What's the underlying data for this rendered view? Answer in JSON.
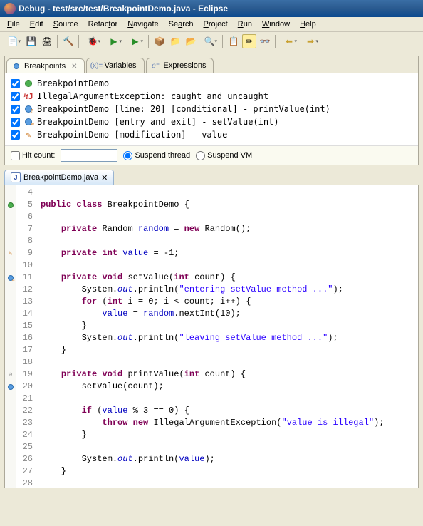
{
  "title": "Debug - test/src/test/BreakpointDemo.java - Eclipse",
  "menu": {
    "file": "File",
    "edit": "Edit",
    "source": "Source",
    "refactor": "Refactor",
    "navigate": "Navigate",
    "search": "Search",
    "project": "Project",
    "run": "Run",
    "window": "Window",
    "help": "Help"
  },
  "views": {
    "breakpoints": "Breakpoints",
    "variables": "Variables",
    "expressions": "Expressions"
  },
  "breakpoints": [
    {
      "label": "BreakpointDemo",
      "icon": "run"
    },
    {
      "label": "IllegalArgumentException: caught and uncaught",
      "icon": "exception"
    },
    {
      "label": "BreakpointDemo [line: 20] [conditional] - printValue(int)",
      "icon": "conditional"
    },
    {
      "label": "BreakpointDemo [entry and exit] - setValue(int)",
      "icon": "entry-exit"
    },
    {
      "label": "BreakpointDemo [modification] - value",
      "icon": "modification"
    }
  ],
  "bp_controls": {
    "hit_count_label": "Hit count:",
    "hit_count_value": "",
    "suspend_thread": "Suspend thread",
    "suspend_vm": "Suspend VM"
  },
  "editor_tab": "BreakpointDemo.java",
  "code": {
    "lines": [
      {
        "n": 4,
        "ruler": "",
        "html": ""
      },
      {
        "n": 5,
        "ruler": "run",
        "html": "<span class='kw'>public</span> <span class='kw'>class</span> BreakpointDemo {"
      },
      {
        "n": 6,
        "ruler": "",
        "html": ""
      },
      {
        "n": 7,
        "ruler": "",
        "html": "    <span class='kw'>private</span> Random <span class='field'>random</span> = <span class='kw'>new</span> Random();"
      },
      {
        "n": 8,
        "ruler": "",
        "html": ""
      },
      {
        "n": 9,
        "ruler": "mod",
        "html": "    <span class='kw'>private</span> <span class='kw'>int</span> <span class='field'>value</span> = -1;"
      },
      {
        "n": 10,
        "ruler": "",
        "html": ""
      },
      {
        "n": 11,
        "ruler": "entry",
        "html": "    <span class='kw'>private</span> <span class='kw'>void</span> setValue(<span class='kw'>int</span> count) {"
      },
      {
        "n": 12,
        "ruler": "",
        "html": "        System.<span class='sfield'>out</span>.println(<span class='str'>\"entering setValue method ...\"</span>);"
      },
      {
        "n": 13,
        "ruler": "",
        "html": "        <span class='kw'>for</span> (<span class='kw'>int</span> i = 0; i &lt; count; i++) {"
      },
      {
        "n": 14,
        "ruler": "",
        "html": "            <span class='field'>value</span> = <span class='field'>random</span>.nextInt(10);"
      },
      {
        "n": 15,
        "ruler": "",
        "html": "        }"
      },
      {
        "n": 16,
        "ruler": "",
        "html": "        System.<span class='sfield'>out</span>.println(<span class='str'>\"leaving setValue method ...\"</span>);"
      },
      {
        "n": 17,
        "ruler": "",
        "html": "    }"
      },
      {
        "n": 18,
        "ruler": "",
        "html": ""
      },
      {
        "n": 19,
        "ruler": "fold",
        "html": "    <span class='kw'>private</span> <span class='kw'>void</span> printValue(<span class='kw'>int</span> count) {"
      },
      {
        "n": 20,
        "ruler": "bp",
        "html": "        setValue(count);"
      },
      {
        "n": 21,
        "ruler": "",
        "html": ""
      },
      {
        "n": 22,
        "ruler": "",
        "html": "        <span class='kw'>if</span> (<span class='field'>value</span> % 3 == 0) {"
      },
      {
        "n": 23,
        "ruler": "",
        "html": "            <span class='kw'>throw</span> <span class='kw'>new</span> IllegalArgumentException(<span class='str'>\"value is illegal\"</span>);"
      },
      {
        "n": 24,
        "ruler": "",
        "html": "        }"
      },
      {
        "n": 25,
        "ruler": "",
        "html": ""
      },
      {
        "n": 26,
        "ruler": "",
        "html": "        System.<span class='sfield'>out</span>.println(<span class='field'>value</span>);"
      },
      {
        "n": 27,
        "ruler": "",
        "html": "    }"
      },
      {
        "n": 28,
        "ruler": "",
        "html": ""
      }
    ]
  }
}
